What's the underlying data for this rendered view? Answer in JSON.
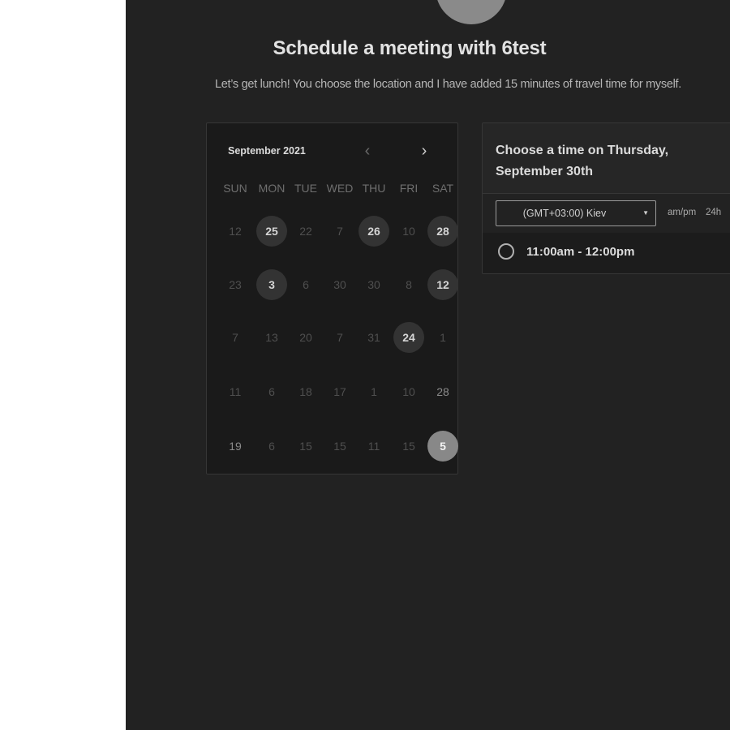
{
  "header": {
    "title": "Schedule a meeting with 6test",
    "subtitle": "Let’s get lunch! You choose the location and I have added 15 minutes of travel time for myself."
  },
  "calendar": {
    "month": "September 2021",
    "prev_icon": "chevron-left-icon",
    "next_icon": "chevron-right-icon",
    "weekdays": [
      "SUN",
      "MON",
      "TUE",
      "WED",
      "THU",
      "FRI",
      "SAT"
    ],
    "weeks": [
      [
        {
          "t": "12",
          "s": "off"
        },
        {
          "t": "25",
          "s": "avail"
        },
        {
          "t": "22",
          "s": "off"
        },
        {
          "t": "7",
          "s": "off"
        },
        {
          "t": "26",
          "s": "avail"
        },
        {
          "t": "10",
          "s": "off"
        },
        {
          "t": "28",
          "s": "avail"
        }
      ],
      [
        {
          "t": "23",
          "s": "off"
        },
        {
          "t": "3",
          "s": "avail"
        },
        {
          "t": "6",
          "s": "off"
        },
        {
          "t": "30",
          "s": "off"
        },
        {
          "t": "30",
          "s": "off"
        },
        {
          "t": "8",
          "s": "off"
        },
        {
          "t": "12",
          "s": "avail"
        }
      ],
      [
        {
          "t": "7",
          "s": "off"
        },
        {
          "t": "13",
          "s": "off"
        },
        {
          "t": "20",
          "s": "off"
        },
        {
          "t": "7",
          "s": "off"
        },
        {
          "t": "31",
          "s": "off"
        },
        {
          "t": "24",
          "s": "avail"
        },
        {
          "t": "1",
          "s": "off"
        }
      ],
      [
        {
          "t": "11",
          "s": "off"
        },
        {
          "t": "6",
          "s": "off"
        },
        {
          "t": "18",
          "s": "off"
        },
        {
          "t": "17",
          "s": "off"
        },
        {
          "t": "1",
          "s": "off"
        },
        {
          "t": "10",
          "s": "off"
        },
        {
          "t": "28",
          "s": "plain"
        }
      ],
      [
        {
          "t": "19",
          "s": "plain"
        },
        {
          "t": "6",
          "s": "off"
        },
        {
          "t": "15",
          "s": "off"
        },
        {
          "t": "15",
          "s": "off"
        },
        {
          "t": "11",
          "s": "off"
        },
        {
          "t": "15",
          "s": "off"
        },
        {
          "t": "5",
          "s": "selected"
        }
      ]
    ]
  },
  "time_panel": {
    "heading": "Choose a time on Thursday, September 30th",
    "timezone": "(GMT+03:00) Kiev",
    "format_ampm": "am/pm",
    "format_24h": "24h",
    "slots": [
      {
        "label": "11:00am - 12:00pm"
      }
    ]
  },
  "colors": {
    "background": "#222222",
    "available_day": "#333333",
    "selected_day": "#888888"
  }
}
